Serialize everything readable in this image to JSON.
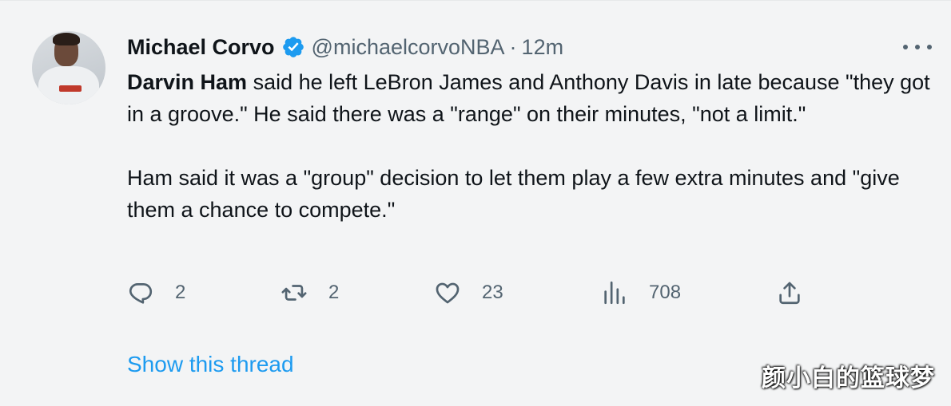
{
  "tweet": {
    "author_name": "Michael Corvo",
    "handle": "@michaelcorvoNBA",
    "separator": "·",
    "time": "12m",
    "paragraph1_bold": "Darvin Ham",
    "paragraph1_rest": " said he left LeBron James and Anthony Davis in late because \"they got in a groove.\" He said there was a \"range\" on their minutes, \"not a limit.\"",
    "paragraph2": "Ham said it was a \"group\" decision to let them play a few extra minutes and \"give them a chance to compete.\""
  },
  "actions": {
    "replies": "2",
    "retweets": "2",
    "likes": "23",
    "views": "708"
  },
  "show_thread": "Show this thread",
  "watermark": "颜小白的篮球梦",
  "icons": {
    "reply": "reply-icon",
    "retweet": "retweet-icon",
    "like": "heart-icon",
    "views": "views-icon",
    "share": "share-icon",
    "verified": "verified-badge-icon",
    "more": "more-icon"
  },
  "colors": {
    "accent": "#1d9bf0",
    "muted": "#536471",
    "text": "#0f1419",
    "background": "#f3f4f5"
  }
}
